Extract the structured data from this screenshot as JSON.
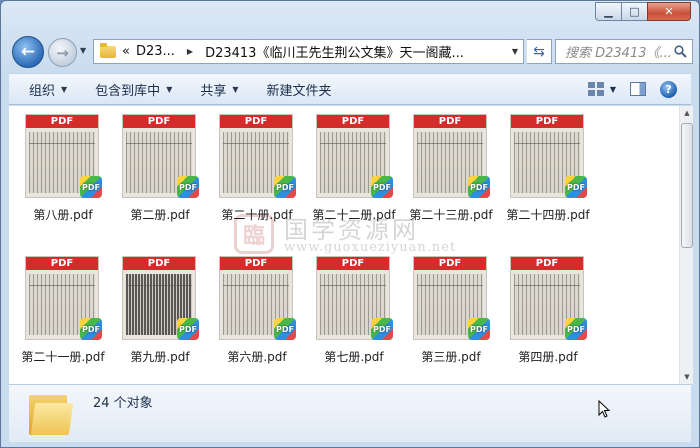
{
  "window": {
    "minimize": "▁",
    "maximize": "□",
    "close": "✕"
  },
  "nav": {
    "back": "←",
    "forward": "→",
    "breadcrumb_prefix": "«",
    "breadcrumbs": [
      "D23...",
      "D23413《临川王先生荆公文集》天一阁藏..."
    ],
    "search_placeholder": "搜索 D23413《..."
  },
  "toolbar": {
    "organize": "组织",
    "include_in_library": "包含到库中",
    "share": "共享",
    "new_folder": "新建文件夹"
  },
  "files": [
    {
      "name": "第八册.pdf",
      "banner": "PDF",
      "badge": "PDF"
    },
    {
      "name": "第二册.pdf",
      "banner": "PDF",
      "badge": "PDF"
    },
    {
      "name": "第二十册.pdf",
      "banner": "PDF",
      "badge": "PDF"
    },
    {
      "name": "第二十二册.pdf",
      "banner": "PDF",
      "badge": "PDF"
    },
    {
      "name": "第二十三册.pdf",
      "banner": "PDF",
      "badge": "PDF"
    },
    {
      "name": "第二十四册.pdf",
      "banner": "PDF",
      "badge": "PDF"
    },
    {
      "name": "第二十一册.pdf",
      "banner": "PDF",
      "badge": "PDF"
    },
    {
      "name": "第九册.pdf",
      "banner": "PDF",
      "badge": "PDF"
    },
    {
      "name": "第六册.pdf",
      "banner": "PDF",
      "badge": "PDF"
    },
    {
      "name": "第七册.pdf",
      "banner": "PDF",
      "badge": "PDF"
    },
    {
      "name": "第三册.pdf",
      "banner": "PDF",
      "badge": "PDF"
    },
    {
      "name": "第四册.pdf",
      "banner": "PDF",
      "badge": "PDF"
    }
  ],
  "watermark": {
    "seal": "臨",
    "name": "国学资源网",
    "url": "www.guoxueziyuan.net"
  },
  "details": {
    "item_count": "24 个对象"
  }
}
